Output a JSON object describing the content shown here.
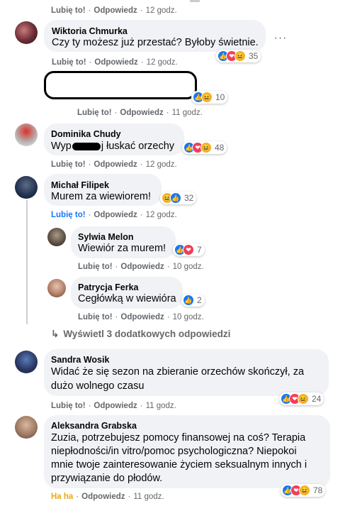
{
  "comments": [
    {
      "name": "",
      "text": "",
      "actions": {
        "like": "Lubię to!",
        "reply": "Odpowiedz",
        "time": "12 godz."
      }
    },
    {
      "name": "Wiktoria Chmurka",
      "text": "Czy ty możesz już przestać? Byłoby świetnie.",
      "actions": {
        "like": "Lubię to!",
        "reply": "Odpowiedz",
        "time": "12 godz."
      },
      "reactions": "35",
      "more_icon": "more-options-icon"
    },
    {
      "name": "",
      "text": "",
      "actions": {
        "like": "Lubię to!",
        "reply": "Odpowiedz",
        "time": "11 godz."
      },
      "reactions": "10",
      "redacted": true
    },
    {
      "name": "Dominika Chudy",
      "text_a": "Wyp",
      "text_b": "j łuskać orzechy",
      "actions": {
        "like": "Lubię to!",
        "reply": "Odpowiedz",
        "time": "12 godz."
      },
      "reactions": "48"
    },
    {
      "name": "Michał Filipek",
      "text": "Murem za wiewiorem!",
      "actions": {
        "like": "Lubię to!",
        "reply": "Odpowiedz",
        "time": "12 godz."
      },
      "reactions": "32"
    },
    {
      "name": "Sylwia Melon",
      "text": "Wiewiór za murem!",
      "actions": {
        "like": "Lubię to!",
        "reply": "Odpowiedz",
        "time": "10 godz."
      },
      "reactions": "7"
    },
    {
      "name": "Patrycja Ferka",
      "text": "Cegłówką w wiewióra",
      "actions": {
        "like": "Lubię to!",
        "reply": "Odpowiedz",
        "time": "10 godz."
      },
      "reactions": "2"
    },
    {
      "name": "Sandra Wosik",
      "text_line1": "Widać że się sezon na zbieranie orzechów skończył, za",
      "text_line2": "dużo wolnego czasu",
      "actions": {
        "like": "Lubię to!",
        "reply": "Odpowiedz",
        "time": "11 godz."
      },
      "reactions": "24"
    },
    {
      "name": "Aleksandra Grabska",
      "lines": [
        "Zuzia, potrzebujesz pomocy finansowej na coś? Terapia",
        "niepłodności/in vitro/pomoc psychologiczna? Niepokoi",
        "mnie twoje zainteresowanie życiem seksualnym innych i",
        "przywiązanie do płodów."
      ],
      "actions": {
        "like": "Ha ha",
        "reply": "Odpowiedz",
        "time": "11 godz."
      },
      "reactions": "78"
    }
  ],
  "view_more": "Wyświetl 3 dodatkowych odpowiedzi",
  "separator": "·",
  "colors": {
    "bubble": "#f0f2f5",
    "link_blue": "#1877f2",
    "haha": "#f7b125",
    "love": "#f33e58"
  }
}
